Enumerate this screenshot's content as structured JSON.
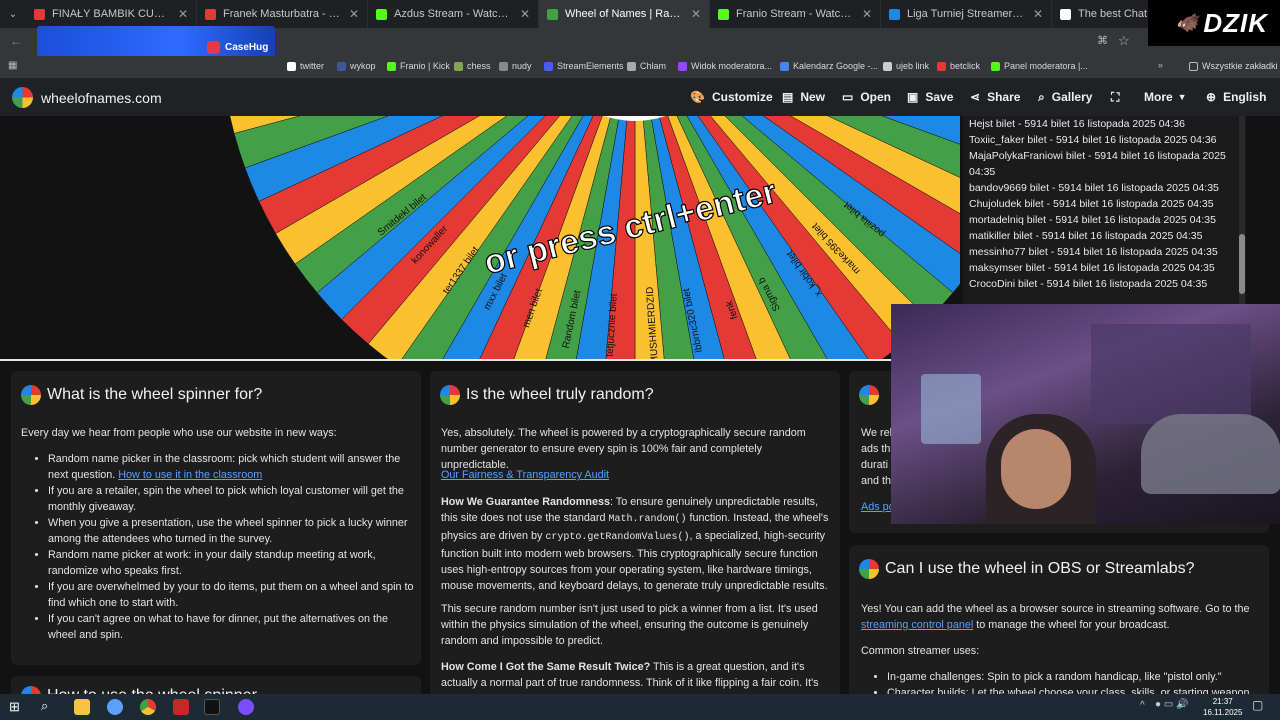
{
  "tabs": [
    {
      "title": "FINAŁY BAMBIK CUP Stream",
      "color": "#e53935"
    },
    {
      "title": "Franek Masturbatra - Don R",
      "color": "#e53935"
    },
    {
      "title": "Azdus Stream - Watch Live on",
      "color": "#53fc18"
    },
    {
      "title": "Wheel of Names | Random nam",
      "color": "#43a047",
      "active": true
    },
    {
      "title": "Franio Stream - Watch Live on",
      "color": "#53fc18"
    },
    {
      "title": "Liga Turniej Streamerów OG Dz",
      "color": "#1e88e5"
    },
    {
      "title": "The best ChatBot and Widgets",
      "color": "#ffffff"
    }
  ],
  "overlay": {
    "dzik": "DZIK",
    "promo": "CaseHug"
  },
  "bookmarks": [
    "twitter",
    "wykop",
    "Franio | Kick",
    "chess",
    "nudy",
    "StreamElements",
    "Chlam",
    "Widok moderatora...",
    "Kalendarz Google -...",
    "ujeb link",
    "betclick",
    "Panel moderatora |...",
    "Wszystkie zakładki"
  ],
  "site": {
    "brand": "wheelofnames.com",
    "nav": [
      "Customize",
      "New",
      "Open",
      "Save",
      "Share",
      "Gallery",
      "Fullscreen",
      "More",
      "English"
    ]
  },
  "wheel": {
    "overlay_text": "or press ctrl+enter",
    "slice_labels": [
      "Smitdekl bilet",
      "konowaller",
      "ter1337 bilet",
      "mxx bilet",
      "men bilet",
      "Random bilet",
      "tetjucznie bilet",
      "MUSHMIERDZID",
      "lbbrnc320 bilet",
      "fenk",
      "Sigma b",
      "x_kobir bilet",
      "marke395 bilet",
      "poziila bilet"
    ]
  },
  "entries": [
    "Hejst bilet - 5914 bilet 16 listopada 2025 04:36",
    "Toxiic_faker bilet - 5914 bilet 16 listopada 2025 04:36",
    "MajaPolykaFraniowi bilet - 5914 bilet 16 listopada 2025 04:35",
    "bandov9669 bilet - 5914 bilet 16 listopada 2025 04:35",
    "Chujoludek bilet - 5914 bilet 16 listopada 2025 04:35",
    "mortadelniq bilet - 5914 bilet 16 listopada 2025 04:35",
    "matikiller bilet - 5914 bilet 16 listopada 2025 04:35",
    "messinho77 bilet - 5914 bilet 16 listopada 2025 04:35",
    "maksymser bilet - 5914 bilet 16 listopada 2025 04:35",
    "CrocoDini bilet - 5914 bilet 16 listopada 2025 04:35"
  ],
  "card1": {
    "title": "What is the wheel spinner for?",
    "intro": "Every day we hear from people who use our website in new ways:",
    "items": [
      "Random name picker in the classroom: pick which student will answer the next question.",
      "If you are a retailer, spin the wheel to pick which loyal customer will get the monthly giveaway.",
      "When you give a presentation, use the wheel spinner to pick a lucky winner among the attendees who turned in the survey.",
      "Random name picker at work: in your daily standup meeting at work, randomize who speaks first.",
      "If you are overwhelmed by your to do items, put them on a wheel and spin to find which one to start with.",
      "If you can't agree on what to have for dinner, put the alternatives on the wheel and spin."
    ],
    "link": "How to use it in the classroom"
  },
  "card2": {
    "title": "Is the wheel truly random?",
    "p1": "Yes, absolutely. The wheel is powered by a cryptographically secure random number generator to ensure every spin is 100% fair and completely unpredictable.",
    "audit_link": "Our Fairness & Transparency Audit",
    "h_guarantee": "How We Guarantee Randomness",
    "p2a": ": To ensure genuinely unpredictable results, this site does not use the standard ",
    "code1": "Math.random()",
    "p2b": " function. Instead, the wheel's physics are driven by ",
    "code2": "crypto.getRandomValues()",
    "p2c": ", a specialized, high-security function built into modern web browsers. This cryptographically secure function uses high-entropy sources from your operating system, like hardware timings, mouse movements, and keyboard delays, to generate truly unpredictable results.",
    "p3": "This secure random number isn't just used to pick a winner from a list. It's used within the physics simulation of the wheel, ensuring the outcome is genuinely random and impossible to predict.",
    "h_same": "How Come I Got the Same Result Twice?",
    "p4": " This is a great question, and it's actually a normal part of true randomness. Think of it like flipping a fair coin. It's entirely"
  },
  "card3": {
    "partial_lines": [
      "We rel",
      "ads th",
      "durati",
      "and th"
    ],
    "ads_link": "Ads po"
  },
  "card4": {
    "title": "Can I use the wheel in OBS or Streamlabs?",
    "p1a": "Yes! You can add the wheel as a browser source in streaming software. Go to the ",
    "p1link": "streaming control panel",
    "p1b": " to manage the wheel for your broadcast.",
    "p2": "Common streamer uses:",
    "items": [
      "In-game challenges: Spin to pick a random handicap, like \"pistol only.\"",
      "Character builds: Let the wheel choose your class, skills, or starting weapon"
    ]
  },
  "card5": {
    "title": "How to use the wheel spinner"
  },
  "taskbar": {
    "time": "21:37",
    "date": "16.11.2025"
  }
}
